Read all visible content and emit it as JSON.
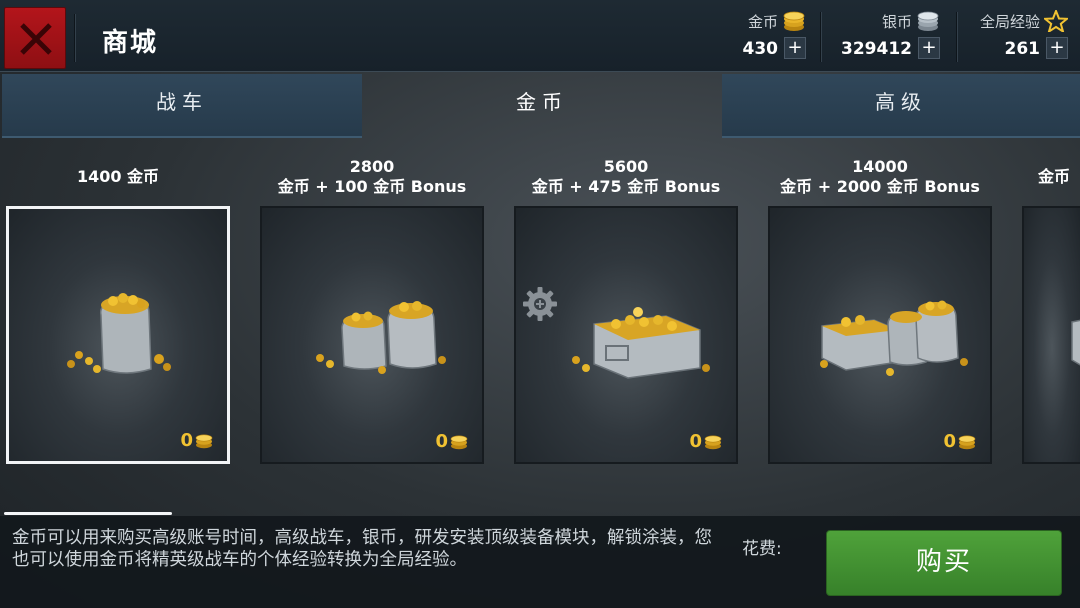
{
  "header": {
    "title": "商城",
    "close_icon": "close-icon",
    "currencies": [
      {
        "label": "金币",
        "value": "430",
        "icon": "gold-coins-icon"
      },
      {
        "label": "银币",
        "value": "329412",
        "icon": "silver-coins-icon"
      },
      {
        "label": "全局经验",
        "value": "261",
        "icon": "star-icon"
      }
    ],
    "plus_symbol": "+"
  },
  "tabs": [
    {
      "label": "战车",
      "active": false
    },
    {
      "label": "金币",
      "active": true
    },
    {
      "label": "高级",
      "active": false
    }
  ],
  "offers": [
    {
      "line1": "1400 金币",
      "line2": "",
      "price": "0",
      "selected": true
    },
    {
      "line1": "2800",
      "line2": "金币 + 100 金币 Bonus",
      "price": "0",
      "selected": false
    },
    {
      "line1": "5600",
      "line2": "金币 + 475 金币 Bonus",
      "price": "0",
      "selected": false
    },
    {
      "line1": "14000",
      "line2": "金币 + 2000 金币 Bonus",
      "price": "0",
      "selected": false
    },
    {
      "line1": "",
      "line2": "金币",
      "price": "",
      "selected": false
    }
  ],
  "description": "金币可以用来购买高级账号时间，高级战车，银币，研发安装顶级装备模块，解锁涂装，您也可以使用金币将精英级战车的个体经验转换为全局经验。",
  "cost_label": "花费:",
  "buy_button": "购买",
  "colors": {
    "gold": "#f1c232",
    "buy_green": "#4a9a37",
    "close_red": "#a8141a",
    "tab_blue": "#2c4356"
  }
}
